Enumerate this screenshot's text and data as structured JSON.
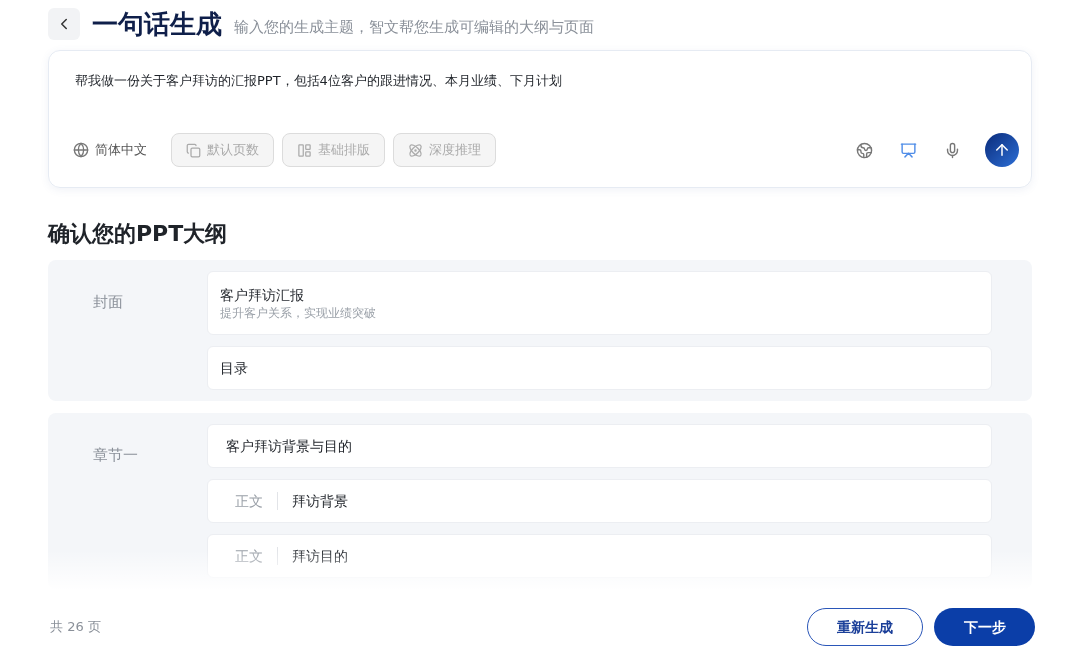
{
  "header": {
    "title": "一句话生成",
    "subtitle": "输入您的生成主题，智文帮您生成可编辑的大纲与页面"
  },
  "prompt": {
    "value": "帮我做一份关于客户拜访的汇报PPT，包括4位客户的跟进情况、本月业绩、下月计划",
    "language": "简体中文",
    "options": [
      {
        "kind": "pages",
        "label": "默认页数",
        "disabled": true
      },
      {
        "kind": "layout",
        "label": "基础排版",
        "disabled": true
      },
      {
        "kind": "reasoning",
        "label": "深度推理",
        "disabled": true
      }
    ],
    "tools": [
      {
        "kind": "web",
        "selected": false
      },
      {
        "kind": "screen",
        "selected": true
      },
      {
        "kind": "voice",
        "selected": false
      }
    ]
  },
  "outline": {
    "heading": "确认您的PPT大纲",
    "sections": [
      {
        "label": "封面",
        "items": [
          {
            "kind": "title",
            "text": "客户拜访汇报",
            "subtitle": "提升客户关系，实现业绩突破"
          },
          {
            "kind": "plain",
            "text": "目录"
          }
        ]
      },
      {
        "label": "章节一",
        "items": [
          {
            "kind": "chapter",
            "text": "客户拜访背景与目的"
          },
          {
            "kind": "body",
            "tag": "正文",
            "text": "拜访背景"
          },
          {
            "kind": "body",
            "tag": "正文",
            "text": "拜访目的"
          }
        ]
      }
    ]
  },
  "footer": {
    "count": "共 26 页",
    "secondary": "重新生成",
    "primary": "下一步"
  }
}
